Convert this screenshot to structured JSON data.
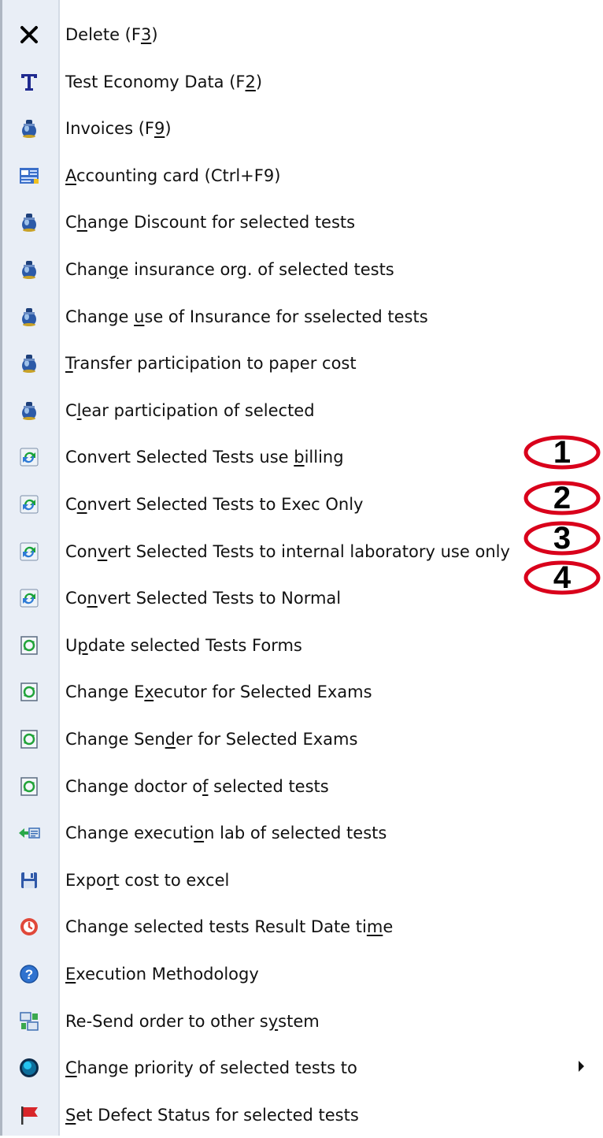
{
  "menu": {
    "items": [
      {
        "icon": "delete-x-icon",
        "segments": [
          "Delete (F",
          "3",
          ")"
        ],
        "underline": [
          1
        ]
      },
      {
        "icon": "text-t-icon",
        "segments": [
          "Test Economy Data (F",
          "2",
          ")"
        ],
        "underline": [
          1
        ]
      },
      {
        "icon": "money-bag-icon",
        "segments": [
          "Invoices (F",
          "9",
          ")"
        ],
        "underline": [
          1
        ]
      },
      {
        "icon": "accounting-card-icon",
        "segments": [
          "A",
          "ccounting card (Ctrl+F9)"
        ],
        "underline": [
          0
        ]
      },
      {
        "icon": "money-bag-icon",
        "segments": [
          "C",
          "h",
          "ange Discount for selected tests"
        ],
        "underline": [
          1
        ]
      },
      {
        "icon": "money-bag-icon",
        "segments": [
          "Chan",
          "g",
          "e insurance org. of selected tests"
        ],
        "underline": [
          1
        ]
      },
      {
        "icon": "money-bag-icon",
        "segments": [
          "Change ",
          "u",
          "se of Insurance for sselected tests"
        ],
        "underline": [
          1
        ]
      },
      {
        "icon": "money-bag-icon",
        "segments": [
          "T",
          "ransfer participation to paper cost"
        ],
        "underline": [
          0
        ]
      },
      {
        "icon": "money-bag-icon",
        "segments": [
          "C",
          "l",
          "ear participation of selected"
        ],
        "underline": [
          1
        ]
      },
      {
        "icon": "convert-icon",
        "segments": [
          "Convert Selected Tests use ",
          "b",
          "illing"
        ],
        "underline": [
          1
        ]
      },
      {
        "icon": "convert-icon",
        "segments": [
          "C",
          "o",
          "nvert Selected Tests to Exec Only"
        ],
        "underline": [
          1
        ]
      },
      {
        "icon": "convert-icon",
        "segments": [
          "Con",
          "v",
          "ert Selected Tests to internal laboratory use only"
        ],
        "underline": [
          1
        ]
      },
      {
        "icon": "convert-icon",
        "segments": [
          "Co",
          "n",
          "vert Selected Tests to Normal"
        ],
        "underline": [
          1
        ]
      },
      {
        "icon": "refresh-form-icon",
        "segments": [
          "U",
          "p",
          "date selected Tests Forms"
        ],
        "underline": [
          1
        ]
      },
      {
        "icon": "refresh-form-icon",
        "segments": [
          "Change E",
          "x",
          "ecutor for Selected Exams"
        ],
        "underline": [
          1
        ]
      },
      {
        "icon": "refresh-form-icon",
        "segments": [
          "Change Sen",
          "d",
          "er for Selected Exams"
        ],
        "underline": [
          1
        ]
      },
      {
        "icon": "refresh-form-icon",
        "segments": [
          "Change doctor o",
          "f",
          " selected tests"
        ],
        "underline": [
          1
        ]
      },
      {
        "icon": "lab-transfer-icon",
        "segments": [
          "Change executi",
          "o",
          "n lab of selected tests"
        ],
        "underline": [
          1
        ]
      },
      {
        "icon": "save-disk-icon",
        "segments": [
          "Expo",
          "r",
          "t cost to excel"
        ],
        "underline": [
          1
        ]
      },
      {
        "icon": "clock-icon",
        "segments": [
          "Change selected tests Result Date ti",
          "m",
          "e"
        ],
        "underline": [
          1
        ]
      },
      {
        "icon": "help-icon",
        "segments": [
          "E",
          "xecution Methodology"
        ],
        "underline": [
          0
        ]
      },
      {
        "icon": "resend-icon",
        "segments": [
          "Re-Send order to other s",
          "y",
          "stem"
        ],
        "underline": [
          1
        ]
      },
      {
        "icon": "priority-ball-icon",
        "segments": [
          "C",
          "hange priority of selected tests to"
        ],
        "underline": [
          0
        ],
        "submenu": true
      },
      {
        "icon": "flag-icon",
        "segments": [
          "S",
          "et Defect Status for selected tests"
        ],
        "underline": [
          0
        ]
      }
    ]
  },
  "annotations": [
    "1",
    "2",
    "3",
    "4"
  ],
  "colors": {
    "annotation_ring": "#d9001b",
    "icon_strip": "#e9eef6"
  }
}
